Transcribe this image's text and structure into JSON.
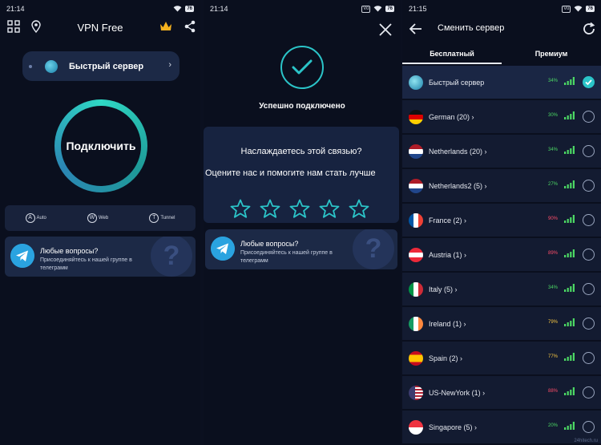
{
  "screen1": {
    "status": {
      "time": "21:14",
      "battery": "76"
    },
    "app_title": "VPN Free",
    "server_pill": {
      "label": "Быстрый сервер"
    },
    "connect_label": "Подключить",
    "modes": [
      {
        "icon": "A",
        "label": "Auto",
        "icon_name": "auto-mode-icon"
      },
      {
        "icon": "W",
        "label": "Web",
        "icon_name": "web-mode-icon"
      },
      {
        "icon": "T",
        "label": "Tunnel",
        "icon_name": "tunnel-mode-icon"
      }
    ],
    "telegram": {
      "title": "Любые вопросы?",
      "subtitle": "Присоединяйтесь к нашей группе в телеграмм"
    }
  },
  "screen2": {
    "status": {
      "time": "21:14",
      "battery": "76"
    },
    "success": "Успешно подключено",
    "rate": {
      "question": "Наслаждаетесь этой связью?",
      "prompt": "Оцените нас и помогите нам стать лучше",
      "stars": 5
    },
    "telegram": {
      "title": "Любые вопросы?",
      "subtitle": "Присоединяйтесь к нашей группе в телеграмм"
    }
  },
  "screen3": {
    "status": {
      "time": "21:15",
      "battery": "76"
    },
    "title": "Сменить сервер",
    "tabs": [
      "Бесплатный",
      "Премиум"
    ],
    "servers": [
      {
        "name": "Быстрый сервер",
        "load": "34%",
        "flag": "globe",
        "load_color": "#4cd964",
        "selected": true
      },
      {
        "name": "German (20) ›",
        "load": "30%",
        "flag": "de",
        "load_color": "#4cd964",
        "selected": false
      },
      {
        "name": "Netherlands (20) ›",
        "load": "34%",
        "flag": "nl",
        "load_color": "#4cd964",
        "selected": false
      },
      {
        "name": "Netherlands2 (5) ›",
        "load": "27%",
        "flag": "nl",
        "load_color": "#4cd964",
        "selected": false
      },
      {
        "name": "France (2) ›",
        "load": "90%",
        "flag": "fr",
        "load_color": "#ff4d6a",
        "selected": false
      },
      {
        "name": "Austria (1) ›",
        "load": "89%",
        "flag": "at",
        "load_color": "#ff4d6a",
        "selected": false
      },
      {
        "name": "Italy (5) ›",
        "load": "34%",
        "flag": "it",
        "load_color": "#4cd964",
        "selected": false
      },
      {
        "name": "Ireland (1) ›",
        "load": "79%",
        "flag": "ie",
        "load_color": "#f5c542",
        "selected": false
      },
      {
        "name": "Spain (2) ›",
        "load": "77%",
        "flag": "es",
        "load_color": "#f5c542",
        "selected": false
      },
      {
        "name": "US-NewYork (1) ›",
        "load": "88%",
        "flag": "us",
        "load_color": "#ff4d6a",
        "selected": false
      },
      {
        "name": "Singapore (5) ›",
        "load": "20%",
        "flag": "sg",
        "load_color": "#4cd964",
        "selected": false
      }
    ],
    "watermark": "24hitech.ru"
  },
  "colors": {
    "accent": "#2bc4c8",
    "card": "#1c2946",
    "bg": "#0a0f1e"
  }
}
